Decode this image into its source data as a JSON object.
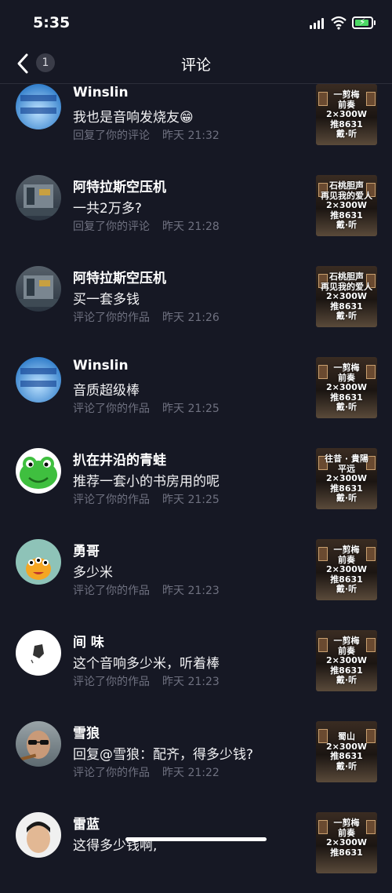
{
  "status_bar": {
    "time": "5:35"
  },
  "nav": {
    "title": "评论",
    "badge": "1"
  },
  "comments": [
    {
      "name": "Winslin",
      "text": "我也是音响发烧友😁",
      "action": "回复了你的评论",
      "time": "昨天 21:32",
      "avatar": "avatar-blue-sky",
      "thumb_lines": [
        "一剪梅",
        "前奏",
        "2×300W",
        "推8631",
        "戴·听"
      ]
    },
    {
      "name": "阿特拉斯空压机",
      "text": "一共2万多?",
      "action": "回复了你的评论",
      "time": "昨天 21:28",
      "avatar": "avatar-machine",
      "thumb_lines": [
        "石桃胆声",
        "再见我的爱人",
        "2×300W",
        "推8631",
        "戴·听"
      ]
    },
    {
      "name": "阿特拉斯空压机",
      "text": "买一套多钱",
      "action": "评论了你的作品",
      "time": "昨天 21:26",
      "avatar": "avatar-machine",
      "thumb_lines": [
        "石桃胆声",
        "再见我的爱人",
        "2×300W",
        "推8631",
        "戴·听"
      ]
    },
    {
      "name": "Winslin",
      "text": "音质超级棒",
      "action": "评论了你的作品",
      "time": "昨天 21:25",
      "avatar": "avatar-blue-sky",
      "thumb_lines": [
        "一剪梅",
        "前奏",
        "2×300W",
        "推8631",
        "戴·听"
      ]
    },
    {
      "name": "扒在井沿的青蛙",
      "text": "推荐一套小的书房用的呢",
      "action": "评论了你的作品",
      "time": "昨天 21:25",
      "avatar": "avatar-frog",
      "thumb_lines": [
        "往昔 · 貴陽",
        "平远",
        "2×300W",
        "推8631",
        "戴·听"
      ]
    },
    {
      "name": "勇哥",
      "text": "多少米",
      "action": "评论了你的作品",
      "time": "昨天 21:23",
      "avatar": "avatar-monster",
      "thumb_lines": [
        "一剪梅",
        "前奏",
        "2×300W",
        "推8631",
        "戴·听"
      ]
    },
    {
      "name": "间 味",
      "text": "这个音响多少米，听着棒",
      "action": "评论了你的作品",
      "time": "昨天 21:23",
      "avatar": "avatar-sketch",
      "thumb_lines": [
        "一剪梅",
        "前奏",
        "2×300W",
        "推8631",
        "戴·听"
      ]
    },
    {
      "name": "雪狼",
      "text": "回复@雪狼：配齐，得多少钱?",
      "action": "评论了你的作品",
      "time": "昨天 21:22",
      "avatar": "avatar-man-glasses",
      "thumb_lines": [
        "蜀山",
        "2×300W",
        "推8631",
        "戴·听"
      ]
    },
    {
      "name": "雷蓝",
      "text": "这得多少钱啊,",
      "action": "",
      "time": "",
      "avatar": "avatar-man",
      "thumb_lines": [
        "一剪梅",
        "前奏",
        "2×300W",
        "推8631"
      ]
    }
  ]
}
